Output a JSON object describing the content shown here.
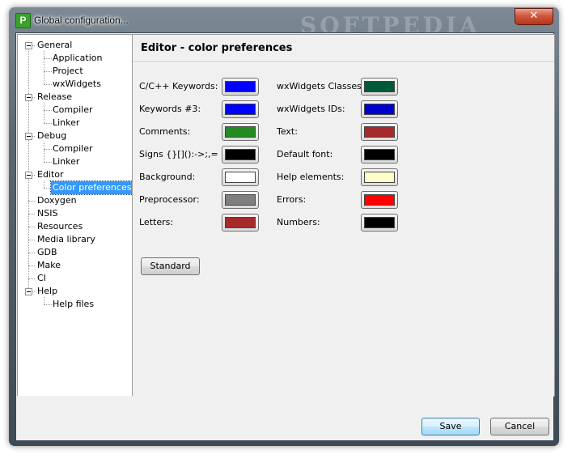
{
  "window": {
    "title": "Global configuration...",
    "close_symbol": "✕",
    "icon_letter": "P",
    "watermark": "SOFTPEDIA"
  },
  "tree": {
    "items": [
      {
        "label": "General",
        "level": 0
      },
      {
        "label": "Application",
        "level": 1
      },
      {
        "label": "Project",
        "level": 1
      },
      {
        "label": "wxWidgets",
        "level": 1
      },
      {
        "label": "Release",
        "level": 0
      },
      {
        "label": "Compiler",
        "level": 1
      },
      {
        "label": "Linker",
        "level": 1
      },
      {
        "label": "Debug",
        "level": 0
      },
      {
        "label": "Compiler",
        "level": 1
      },
      {
        "label": "Linker",
        "level": 1
      },
      {
        "label": "Editor",
        "level": 0
      },
      {
        "label": "Color preferences",
        "level": 1,
        "selected": true
      },
      {
        "label": "Doxygen",
        "level": 0
      },
      {
        "label": "NSIS",
        "level": 0
      },
      {
        "label": "Resources",
        "level": 0
      },
      {
        "label": "Media library",
        "level": 0
      },
      {
        "label": "GDB",
        "level": 0
      },
      {
        "label": "Make",
        "level": 0
      },
      {
        "label": "CI",
        "level": 0
      },
      {
        "label": "Help",
        "level": 0
      },
      {
        "label": "Help files",
        "level": 1
      }
    ]
  },
  "panel": {
    "title": "Editor - color preferences",
    "left_colors": [
      {
        "label": "C/C++ Keywords:",
        "color": "#0000ff"
      },
      {
        "label": "Keywords #3:",
        "color": "#0000ff"
      },
      {
        "label": "Comments:",
        "color": "#228b22"
      },
      {
        "label": "Signs {}[]():->;,=",
        "color": "#000000"
      },
      {
        "label": "Background:",
        "color": "#ffffff"
      },
      {
        "label": "Preprocessor:",
        "color": "#808080"
      },
      {
        "label": "Letters:",
        "color": "#a52a2a"
      }
    ],
    "right_colors": [
      {
        "label": "wxWidgets Classes:",
        "color": "#005a37"
      },
      {
        "label": "wxWidgets IDs:",
        "color": "#0000cd"
      },
      {
        "label": "Text:",
        "color": "#a52a2a"
      },
      {
        "label": "Default font:",
        "color": "#000000"
      },
      {
        "label": "Help elements:",
        "color": "#ffffcc"
      },
      {
        "label": "Errors:",
        "color": "#ff0000"
      },
      {
        "label": "Numbers:",
        "color": "#000000"
      }
    ],
    "standard_label": "Standard"
  },
  "buttons": {
    "save": "Save",
    "cancel": "Cancel"
  }
}
